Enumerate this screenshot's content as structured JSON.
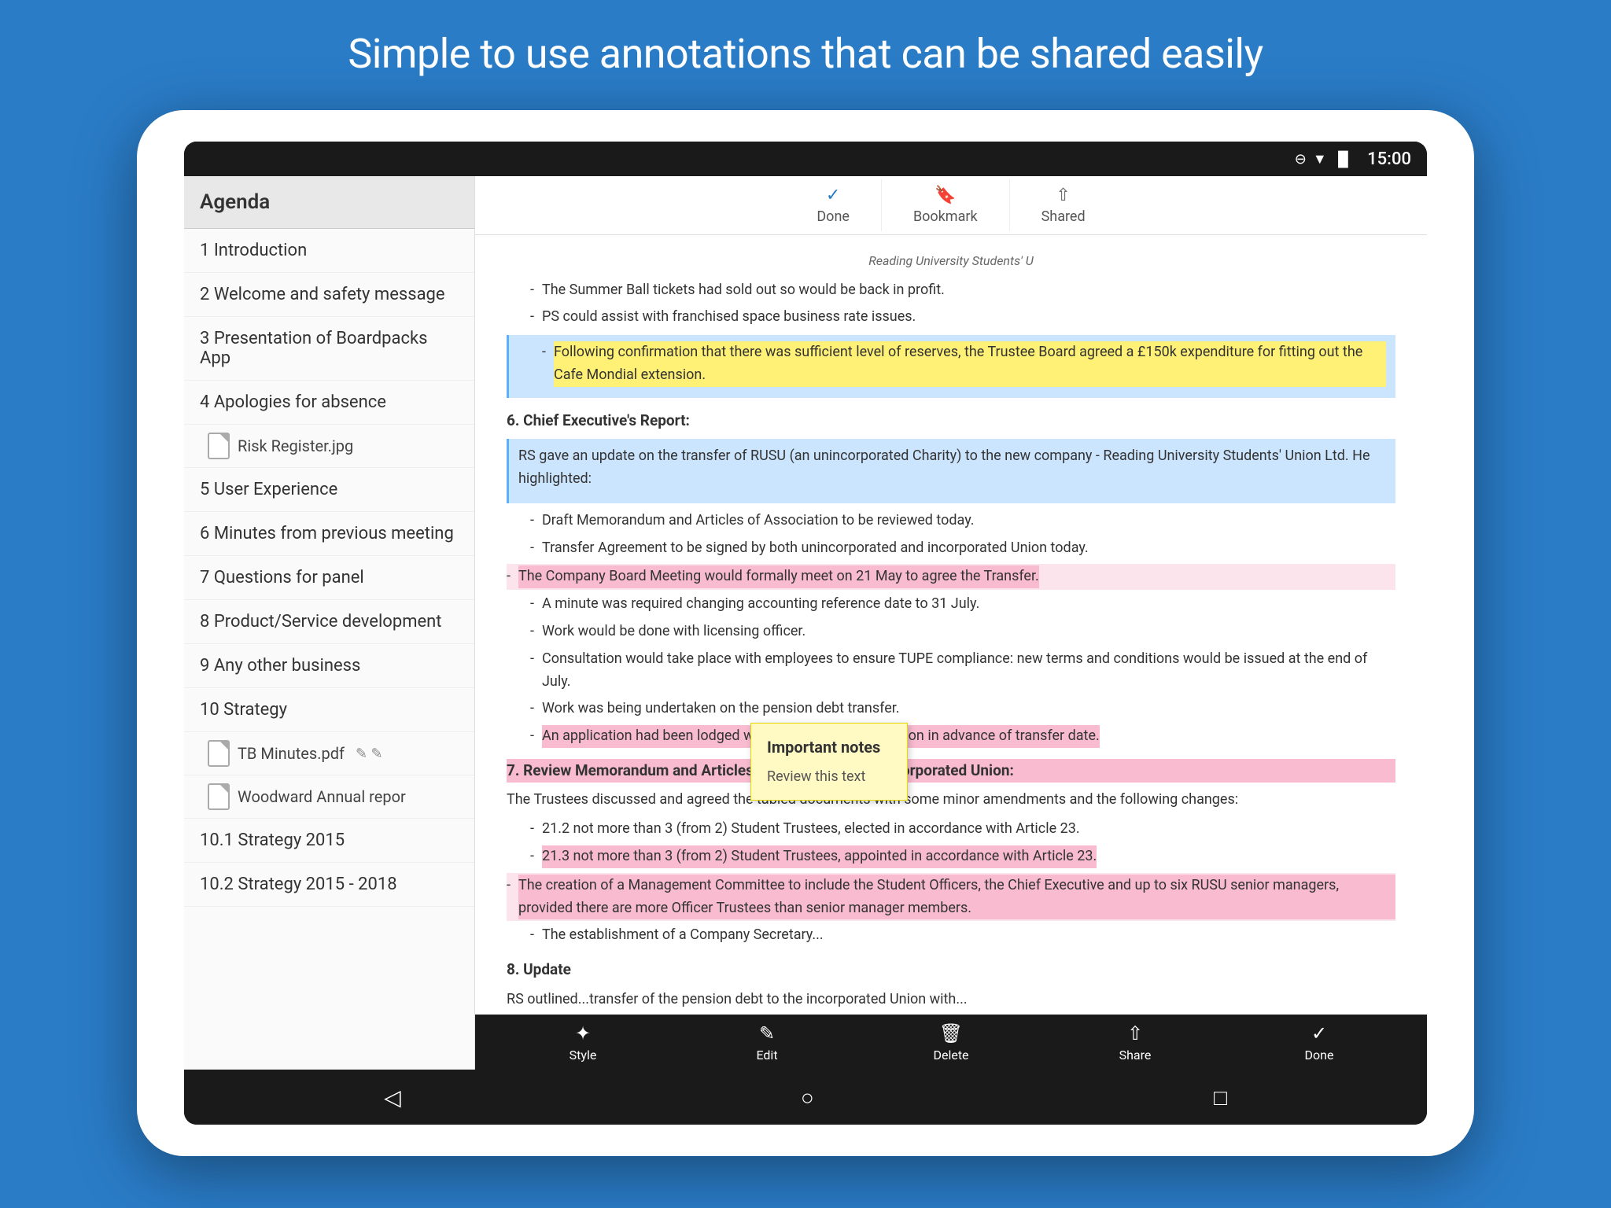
{
  "page": {
    "title": "Simple to use annotations that can be shared easily"
  },
  "status_bar": {
    "time": "15:00",
    "icons": [
      "⊖",
      "▼",
      "▐▐"
    ]
  },
  "top_toolbar": {
    "done_label": "Done",
    "bookmark_label": "Bookmark",
    "shared_label": "Shared"
  },
  "sidebar": {
    "header": "Agenda",
    "items": [
      {
        "label": "1 Introduction",
        "id": "item-1"
      },
      {
        "label": "2 Welcome and safety message",
        "id": "item-2"
      },
      {
        "label": "3 Presentation of Boardpacks App",
        "id": "item-3"
      },
      {
        "label": "4 Apologies for absence",
        "id": "item-4",
        "sub_items": [
          {
            "label": "Risk Register.jpg",
            "type": "image"
          }
        ]
      },
      {
        "label": "5 User Experience",
        "id": "item-5"
      },
      {
        "label": "6 Minutes from previous meeting",
        "id": "item-6"
      },
      {
        "label": "7 Questions for panel",
        "id": "item-7"
      },
      {
        "label": "8 Product/Service development",
        "id": "item-8"
      },
      {
        "label": "9 Any other business",
        "id": "item-9"
      },
      {
        "label": "10 Strategy",
        "id": "item-10",
        "sub_items": [
          {
            "label": "TB Minutes.pdf",
            "type": "pdf"
          },
          {
            "label": "Woodward Annual repor",
            "type": "pdf"
          }
        ]
      },
      {
        "label": "10.1 Strategy 2015",
        "id": "item-10-1"
      },
      {
        "label": "10.2 Strategy 2015 - 2018",
        "id": "item-10-2"
      }
    ]
  },
  "document": {
    "header_text": "Reading University Students' U",
    "bullets_intro": [
      "The Summer Ball tickets had sold out so would be back in profit.",
      "PS could assist with franchised space business rate issues."
    ],
    "highlighted_blue_text": "Following confirmation that there was sufficient level of reserves, the Trustee Board agreed a £150k expenditure for fitting out the Cafe Mondial extension.",
    "section6_title": "6. Chief Executive's Report:",
    "section6_text": "RS gave an update on the transfer of RUSU (an unincorporated Charity) to the new company - Reading University Students' Union Ltd. He highlighted:",
    "section6_bullets": [
      {
        "text": "Draft Memorandum and Articles of Association to be reviewed today.",
        "highlight": false
      },
      {
        "text": "Transfer Agreement to be signed by both unincorporated and incorporated Union today.",
        "highlight": false
      },
      {
        "text": "The Company Board Meeting would formally meet on 21 May to agree the Transfer.",
        "highlight": "pink"
      },
      {
        "text": "A minute was required changing accounting reference date to 31 July.",
        "highlight": false
      },
      {
        "text": "Work would be done with licensing officer.",
        "highlight": false
      },
      {
        "text": "Consultation would take place with employees to ensure TUPE compliance: new terms and conditions would be issued at the end of July.",
        "highlight": false
      },
      {
        "text": "Work was being undertaken on the pension debt transfer.",
        "highlight": false
      },
      {
        "text": "An application had been lodged with the Charity Commission in advance of transfer date.",
        "highlight": "pink"
      }
    ],
    "section7_title": "7. Review Memorandum and Articles of Association for Incorporated Union:",
    "section7_intro": "The Trustees discussed and agreed the tabled documents with some minor amendments and the following changes:",
    "section7_bullets": [
      {
        "text": "21.2 not more than 3 (from 2) Student Trustees, elected in accordance with Article 23.",
        "highlight": false
      },
      {
        "text": "21.3 not more than 3 (from 2) Student Trustees, appointed in accordance with Article 23.",
        "highlight": "pink"
      },
      {
        "text": "The creation of a Management Committee to include the Student Officers, the Chief Executive and up to six RUSU senior managers, provided there are more Officer Trustees than senior manager members.",
        "highlight": "pink"
      },
      {
        "text": "The establishment of a Company Secretary...",
        "highlight": false
      }
    ],
    "section8_title": "8. Update",
    "section8_text": "RS outlined...transfer of the pension debt to the incorporated Union with...",
    "annotation": {
      "title": "Important notes",
      "text": "Review this text"
    }
  },
  "bottom_toolbar": {
    "style_label": "Style",
    "edit_label": "Edit",
    "delete_label": "Delete",
    "share_label": "Share",
    "done_label": "Done"
  }
}
